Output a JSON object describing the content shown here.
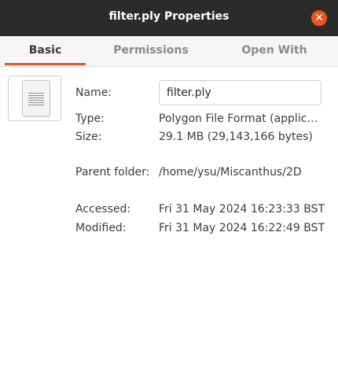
{
  "window": {
    "title": "filter.ply Properties",
    "close_icon": "close-icon",
    "accent_color": "#e95420"
  },
  "tabs": [
    {
      "label": "Basic",
      "active": true
    },
    {
      "label": "Permissions",
      "active": false
    },
    {
      "label": "Open With",
      "active": false
    }
  ],
  "basic": {
    "file_icon": "document-icon",
    "name_label": "Name:",
    "name_value": "filter.ply",
    "type_label": "Type:",
    "type_value": "Polygon File Format (applica…",
    "size_label": "Size:",
    "size_value": "29.1 MB (29,143,166 bytes)",
    "parent_label": "Parent folder:",
    "parent_value": "/home/ysu/Miscanthus/2D",
    "accessed_label": "Accessed:",
    "accessed_value": "Fri 31 May 2024 16:23:33 BST",
    "modified_label": "Modified:",
    "modified_value": "Fri 31 May 2024 16:22:49 BST"
  }
}
